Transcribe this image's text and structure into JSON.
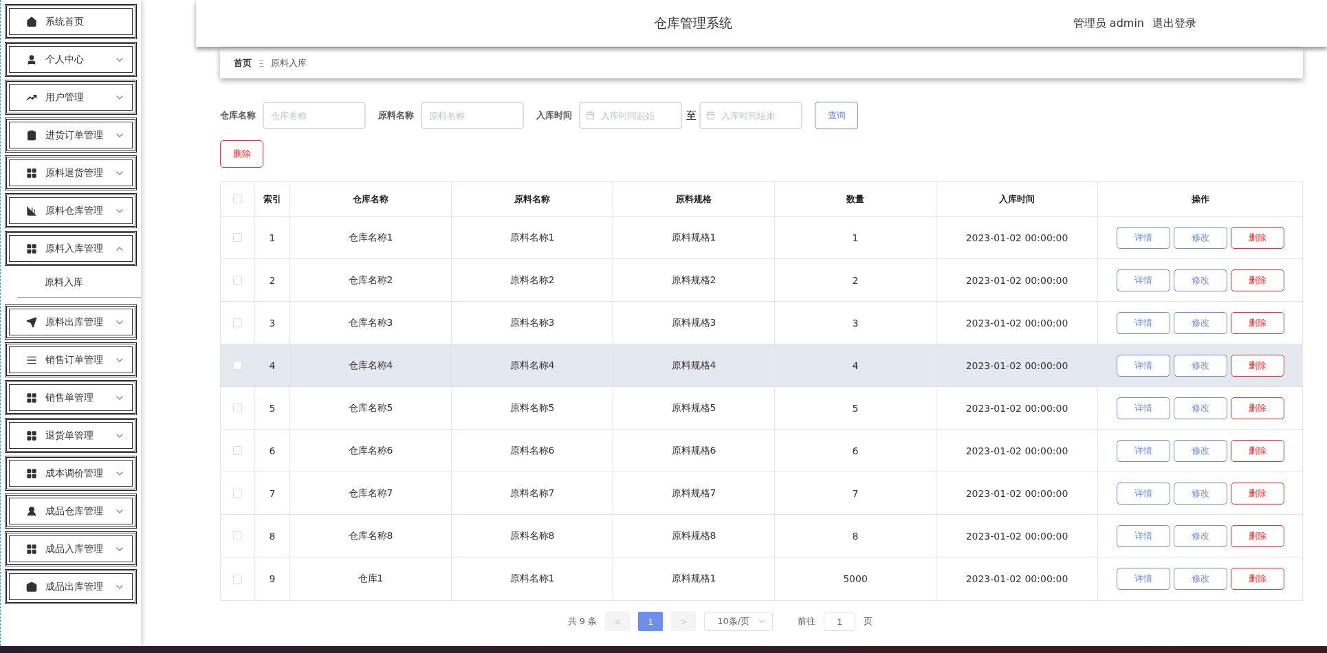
{
  "sidebar": {
    "items": [
      {
        "label": "系统首页"
      },
      {
        "label": "个人中心",
        "expanded": false
      },
      {
        "label": "用户管理",
        "expanded": false
      },
      {
        "label": "进货订单管理",
        "expanded": false
      },
      {
        "label": "原料退货管理",
        "expanded": false
      },
      {
        "label": "原料仓库管理",
        "expanded": false
      },
      {
        "label": "原料入库管理",
        "expanded": true,
        "children": [
          {
            "label": "原料入库"
          }
        ]
      },
      {
        "label": "原料出库管理",
        "expanded": false
      },
      {
        "label": "销售订单管理",
        "expanded": false
      },
      {
        "label": "销售单管理",
        "expanded": false
      },
      {
        "label": "退货单管理",
        "expanded": false
      },
      {
        "label": "成本调价管理",
        "expanded": false
      },
      {
        "label": "成品仓库管理",
        "expanded": false
      },
      {
        "label": "成品入库管理",
        "expanded": false
      },
      {
        "label": "成品出库管理",
        "expanded": false
      }
    ]
  },
  "header": {
    "title": "仓库管理系统",
    "user": "管理员 admin",
    "logout": "退出登录"
  },
  "breadcrumb": {
    "home": "首页",
    "separator": "Ξ",
    "current": "原料入库"
  },
  "filters": [
    {
      "kind": "text",
      "label": "仓库名称",
      "placeholder": "仓库名称"
    },
    {
      "kind": "text",
      "label": "原料名称",
      "placeholder": "原料名称"
    },
    {
      "kind": "daterange",
      "label": "入库时间",
      "placeholder": "入库时间起始",
      "joiner": "至",
      "placeholder_end": "入库时间结束"
    }
  ],
  "search_button": "查询",
  "delete_button": "删除",
  "table": {
    "select_all_checked": false,
    "columns": [
      "索引",
      "仓库名称",
      "原料名称",
      "原料规格",
      "数量",
      "入库时间",
      "操作"
    ],
    "rows": [
      {
        "index": "1",
        "warehouse": "仓库名称1",
        "material": "原料名称1",
        "spec": "原料规格1",
        "qty": "1",
        "time": "2023-01-02 00:00:00",
        "checked": false,
        "highlighted": false,
        "actions": [
          "详情",
          "修改",
          "删除"
        ]
      },
      {
        "index": "2",
        "warehouse": "仓库名称2",
        "material": "原料名称2",
        "spec": "原料规格2",
        "qty": "2",
        "time": "2023-01-02 00:00:00",
        "checked": false,
        "highlighted": false,
        "actions": [
          "详情",
          "修改",
          "删除"
        ]
      },
      {
        "index": "3",
        "warehouse": "仓库名称3",
        "material": "原料名称3",
        "spec": "原料规格3",
        "qty": "3",
        "time": "2023-01-02 00:00:00",
        "checked": false,
        "highlighted": false,
        "actions": [
          "详情",
          "修改",
          "删除"
        ]
      },
      {
        "index": "4",
        "warehouse": "仓库名称4",
        "material": "原料名称4",
        "spec": "原料规格4",
        "qty": "4",
        "time": "2023-01-02 00:00:00",
        "checked": false,
        "highlighted": true,
        "actions": [
          "详情",
          "修改",
          "删除"
        ]
      },
      {
        "index": "5",
        "warehouse": "仓库名称5",
        "material": "原料名称5",
        "spec": "原料规格5",
        "qty": "5",
        "time": "2023-01-02 00:00:00",
        "checked": false,
        "highlighted": false,
        "actions": [
          "详情",
          "修改",
          "删除"
        ]
      },
      {
        "index": "6",
        "warehouse": "仓库名称6",
        "material": "原料名称6",
        "spec": "原料规格6",
        "qty": "6",
        "time": "2023-01-02 00:00:00",
        "checked": false,
        "highlighted": false,
        "actions": [
          "详情",
          "修改",
          "删除"
        ]
      },
      {
        "index": "7",
        "warehouse": "仓库名称7",
        "material": "原料名称7",
        "spec": "原料规格7",
        "qty": "7",
        "time": "2023-01-02 00:00:00",
        "checked": false,
        "highlighted": false,
        "actions": [
          "详情",
          "修改",
          "删除"
        ]
      },
      {
        "index": "8",
        "warehouse": "仓库名称8",
        "material": "原料名称8",
        "spec": "原料规格8",
        "qty": "8",
        "time": "2023-01-02 00:00:00",
        "checked": false,
        "highlighted": false,
        "actions": [
          "详情",
          "修改",
          "删除"
        ]
      },
      {
        "index": "9",
        "warehouse": "仓库1",
        "material": "原料名称1",
        "spec": "原料规格1",
        "qty": "5000",
        "time": "2023-01-02 00:00:00",
        "checked": false,
        "highlighted": false,
        "actions": [
          "详情",
          "修改",
          "删除"
        ]
      }
    ]
  },
  "pagination": {
    "total": "共 9 条",
    "prev": "<",
    "pages": [
      {
        "label": "1",
        "selected": true
      }
    ],
    "next": ">",
    "page_size": "10条/页",
    "goto": "前往",
    "goto_value": "1",
    "page_unit": "页"
  }
}
